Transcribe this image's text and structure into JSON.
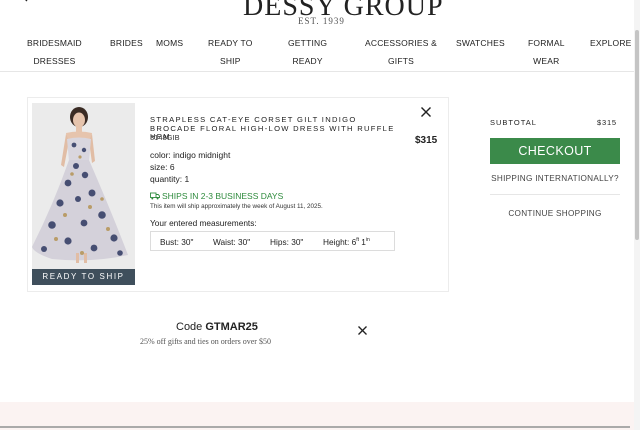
{
  "header": {
    "logo": "DESSY GROUP",
    "tagline": "EST. 1939"
  },
  "nav": {
    "items": [
      {
        "line1": "BRIDESMAID",
        "line2": "DRESSES"
      },
      {
        "line1": "BRIDES",
        "line2": ""
      },
      {
        "line1": "MOMS",
        "line2": ""
      },
      {
        "line1": "READY TO",
        "line2": "SHIP"
      },
      {
        "line1": "GETTING",
        "line2": "READY"
      },
      {
        "line1": "ACCESSORIES &",
        "line2": "GIFTS"
      },
      {
        "line1": "SWATCHES",
        "line2": ""
      },
      {
        "line1": "FORMAL",
        "line2": "WEAR"
      },
      {
        "line1": "EXPLORE",
        "line2": ""
      }
    ]
  },
  "cart_item": {
    "title": "STRAPLESS CAT-EYE CORSET GILT INDIGO BROCADE FLORAL HIGH-LOW DRESS WITH RUFFLE HEM",
    "sku": "3148GIB",
    "price": "$315",
    "badge": "READY TO SHIP",
    "color": "color: indigo midnight",
    "size": "size: 6",
    "quantity": "quantity: 1",
    "shipping_status": "SHIPS IN 2-3 BUSINESS DAYS",
    "shipping_note": "This item will ship approximately the week of August 11, 2025.",
    "measurements_label": "Your entered measurements:",
    "measurements": {
      "bust": "Bust: 30\"",
      "waist": "Waist: 30\"",
      "hips": "Hips: 30\"",
      "height_prefix": "Height: 6",
      "height_ft_sup": "ft",
      "height_inches": " 1",
      "height_in_sup": "in"
    }
  },
  "summary": {
    "subtotal_label": "SUBTOTAL",
    "subtotal_value": "$315",
    "checkout_label": "CHECKOUT",
    "ship_intl_label": "SHIPPING INTERNATIONALLY?",
    "continue_label": "CONTINUE SHOPPING"
  },
  "promo": {
    "code_prefix": "Code ",
    "code": "GTMAR25",
    "description": "25% off gifts and ties on orders over $50"
  },
  "icons": {
    "search": "search-icon",
    "account": "user-icon",
    "bag": "shopping-bag-icon",
    "close": "close-icon",
    "truck": "truck-icon"
  },
  "colors": {
    "checkout": "#3b8a4a",
    "shipping_green": "#2e8b3d",
    "badge_bg": "#3f4f5c",
    "promo_band": "#fbf3f2"
  }
}
